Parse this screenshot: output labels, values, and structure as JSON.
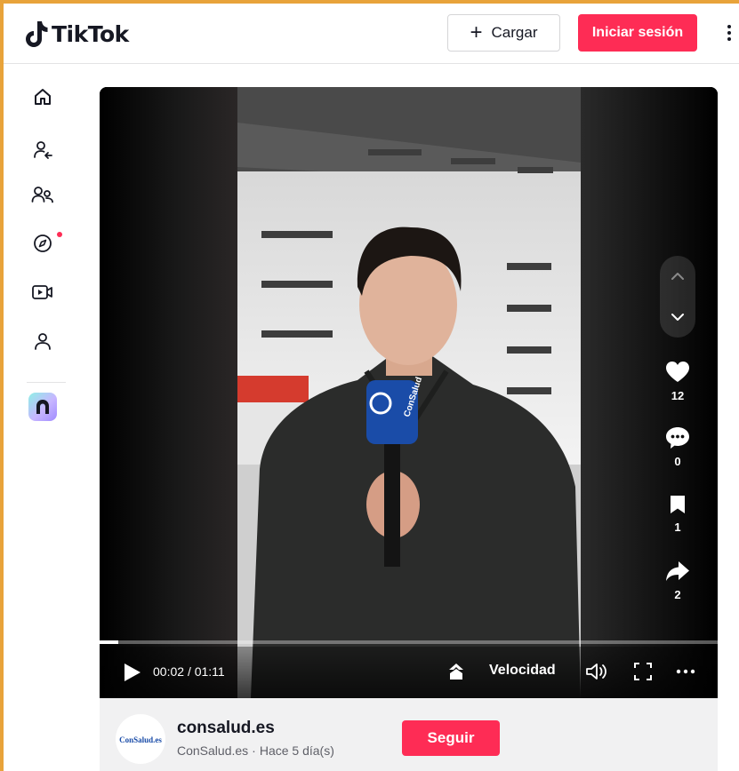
{
  "header": {
    "logo_text": "TikTok",
    "upload_label": "Cargar",
    "login_label": "Iniciar sesión"
  },
  "sidebar": {
    "items": [
      {
        "name": "home",
        "icon": "home-icon"
      },
      {
        "name": "following",
        "icon": "following-icon"
      },
      {
        "name": "friends",
        "icon": "friends-icon"
      },
      {
        "name": "explore",
        "icon": "compass-icon",
        "has_notification_dot": true
      },
      {
        "name": "live",
        "icon": "live-camera-icon"
      },
      {
        "name": "profile",
        "icon": "profile-icon"
      }
    ]
  },
  "video": {
    "current_time": "00:02",
    "duration": "01:11",
    "progress_fraction": 0.03,
    "speed_label": "Velocidad",
    "microphone_brand": "ConSalud",
    "actions": {
      "likes": "12",
      "comments": "0",
      "bookmarks": "1",
      "shares": "2"
    }
  },
  "author": {
    "avatar_text": "ConSalud.es",
    "name": "consalud.es",
    "display_name": "ConSalud.es",
    "separator": "·",
    "posted": "Hace 5 día(s)",
    "follow_label": "Seguir"
  },
  "colors": {
    "accent": "#fe2c55",
    "frame": "#e8a33a"
  }
}
